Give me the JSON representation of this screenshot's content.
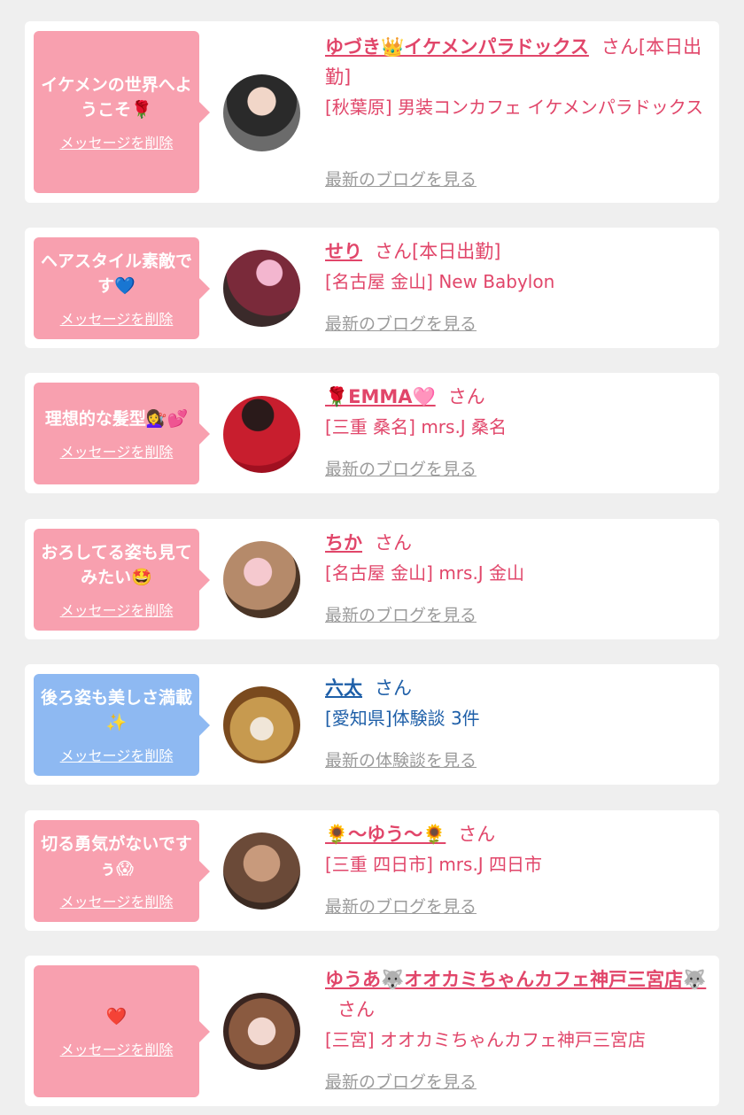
{
  "colors": {
    "pink_bubble": "#f8a0af",
    "blue_bubble": "#8eb9f2",
    "pink_text": "#e1466a",
    "blue_text": "#1e5fa8",
    "blog_link": "#9b9b9b"
  },
  "delete_label": "メッセージを削除",
  "san": "さん",
  "items": [
    {
      "message": "イケメンの世界へようこそ🌹",
      "name": "ゆづき👑イケメンパラドックス",
      "status": "[本日出勤]",
      "shop": "[秋葉原] 男装コンカフェ イケメンパラドックス",
      "link": "最新のブログを見る",
      "theme": "pink"
    },
    {
      "message": "ヘアスタイル素敵です💙",
      "name": "せり",
      "status": "[本日出勤]",
      "shop": "[名古屋 金山] New Babylon",
      "link": "最新のブログを見る",
      "theme": "pink"
    },
    {
      "message": "理想的な髪型💇‍♀️💕",
      "name": "🌹EMMA🩷",
      "status": "",
      "shop": "[三重 桑名] mrs.J 桑名",
      "link": "最新のブログを見る",
      "theme": "pink"
    },
    {
      "message": "おろしてる姿も見てみたい🤩",
      "name": "ちか",
      "status": "",
      "shop": "[名古屋 金山] mrs.J 金山",
      "link": "最新のブログを見る",
      "theme": "pink"
    },
    {
      "message": "後ろ姿も美しさ満載✨",
      "name": "六太",
      "status": "",
      "shop": "[愛知県]体験談 3件",
      "link": "最新の体験談を見る",
      "theme": "blue"
    },
    {
      "message": "切る勇気がないですぅ😱",
      "name": "🌻〜ゆう〜🌻",
      "status": "",
      "shop": "[三重 四日市] mrs.J 四日市",
      "link": "最新のブログを見る",
      "theme": "pink"
    },
    {
      "message": "❤️",
      "name": "ゆうあ🐺オオカミちゃんカフェ神戸三宮店🐺",
      "status": "",
      "shop": "[三宮] オオカミちゃんカフェ神戸三宮店",
      "link": "最新のブログを見る",
      "theme": "pink"
    }
  ]
}
